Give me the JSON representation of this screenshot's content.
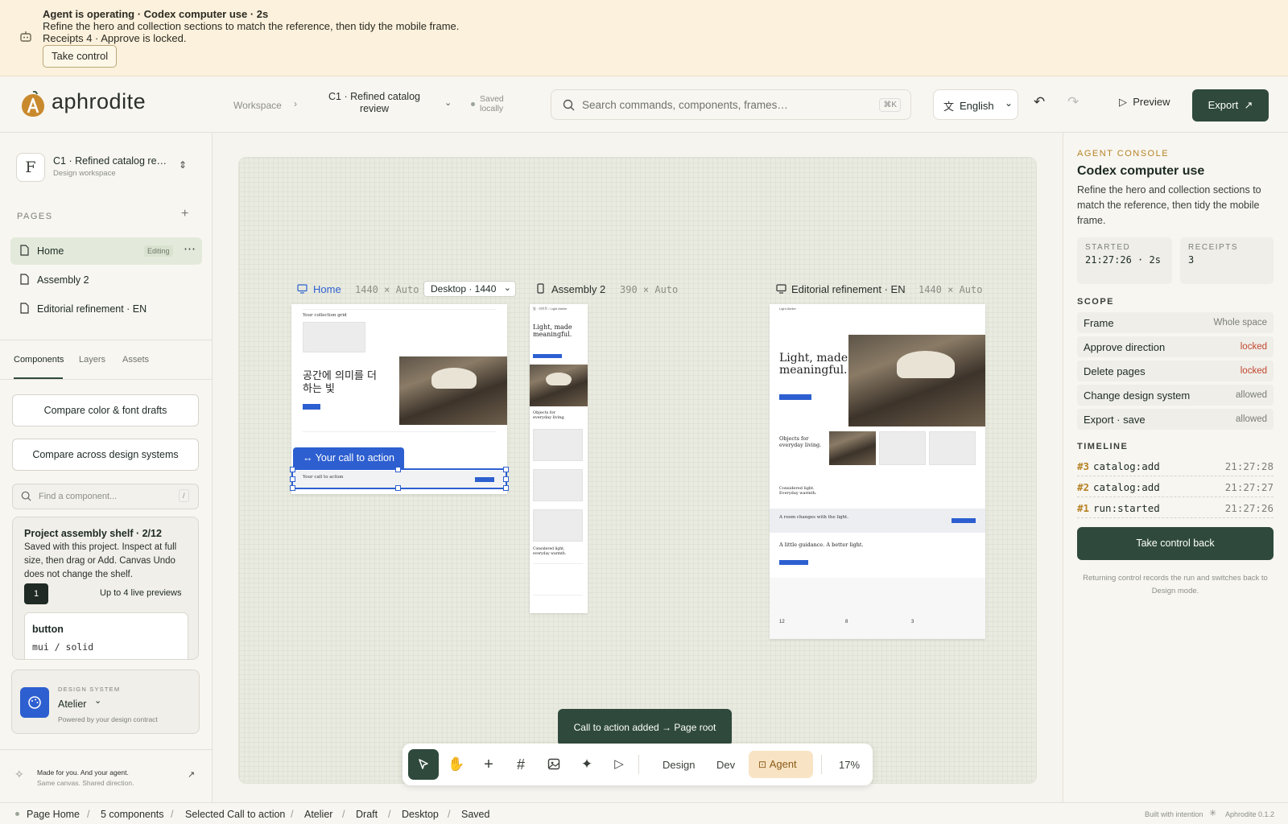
{
  "banner": {
    "title": "Agent is operating · Codex computer use · 2s",
    "line2": "Refine the hero and collection sections to match the reference, then tidy the mobile frame.",
    "line3": "Receipts 4 · Approve is locked.",
    "button": "Take control"
  },
  "header": {
    "logo_text": "aphrodite",
    "workspace": "Workspace",
    "file_title": "C1 · Refined catalog review",
    "saved": "Saved locally",
    "search_placeholder": "Search commands, components, frames…",
    "search_shortcut": "⌘K",
    "language": "English",
    "preview": "Preview",
    "export": "Export"
  },
  "sidebar": {
    "project_initial": "F",
    "project_name": "C1 · Refined catalog re…",
    "project_sub": "Design workspace",
    "pages_label": "PAGES",
    "pages": [
      {
        "label": "Home",
        "badge": "Editing"
      },
      {
        "label": "Assembly 2"
      },
      {
        "label": "Editorial refinement · EN"
      }
    ],
    "tabs": [
      "Components",
      "Layers",
      "Assets"
    ],
    "btn_compare_color": "Compare color & font drafts",
    "btn_compare_systems": "Compare across design systems",
    "find_placeholder": "Find a component...",
    "find_shortcut": "/",
    "shelf_title": "Project assembly shelf · 2/12",
    "shelf_text": "Saved with this project. Inspect at full size, then drag or Add. Canvas Undo does not change the shelf.",
    "shelf_count": "1",
    "shelf_limit": "Up to 4 live previews",
    "card_title": "button",
    "card_sub": "mui / solid",
    "ds_label": "DESIGN SYSTEM",
    "ds_name": "Atelier",
    "ds_sub": "Powered by your design contract",
    "footer_line1": "Made for you. And your agent.",
    "footer_line2": "Same canvas. Shared direction."
  },
  "canvas": {
    "frame1": {
      "label": "Home",
      "size": "1440 × Auto",
      "device": "Desktop · 1440"
    },
    "frame2": {
      "label": "Assembly 2",
      "size": "390 × Auto"
    },
    "frame3": {
      "label": "Editorial refinement · EN",
      "size": "1440 × Auto"
    },
    "home_heading_ko": "공간에 의미를 더하는 빛",
    "home_collection": "Your collection grid",
    "home_cta": "Your call to action",
    "cta_chip": "↔ Your call to action",
    "mob_brand": "빛 · 라이트 / Light Atelier",
    "mob_heading": "Light, made meaningful.",
    "mob_objects": "Objects for everyday living.",
    "mob_crafted": "Considered light, everyday warmth.",
    "ed_brand": "Light Atelier",
    "ed_heading": "Light, made meaningful.",
    "ed_objects": "Objects for everyday living.",
    "ed_crafted": "Considered light. Everyday warmth.",
    "ed_room": "A room changes with the light.",
    "ed_guidance": "A little guidance. A better light.",
    "ed_stats": [
      "12",
      "8",
      "3"
    ],
    "toast": "Call to action added → Page root"
  },
  "toolbar": {
    "modes": [
      "Design",
      "Dev",
      "Agent"
    ],
    "zoom": "17%"
  },
  "agent": {
    "label": "AGENT CONSOLE",
    "title": "Codex computer use",
    "desc": "Refine the hero and collection sections to match the reference, then tidy the mobile frame.",
    "started_label": "STARTED",
    "started_value": "21:27:26 · 2s",
    "receipts_label": "RECEIPTS",
    "receipts_value": "3",
    "scope_label": "SCOPE",
    "scope": [
      {
        "k": "Frame",
        "v": "Whole space",
        "color": "#7b7e78"
      },
      {
        "k": "Approve direction",
        "v": "locked",
        "color": "#c0462f"
      },
      {
        "k": "Delete pages",
        "v": "locked",
        "color": "#c0462f"
      },
      {
        "k": "Change design system",
        "v": "allowed",
        "color": "#7b7e78"
      },
      {
        "k": "Export · save",
        "v": "allowed",
        "color": "#7b7e78"
      }
    ],
    "timeline_label": "TIMELINE",
    "timeline": [
      {
        "id": "#3",
        "event": "catalog:add",
        "time": "21:27:28"
      },
      {
        "id": "#2",
        "event": "catalog:add",
        "time": "21:27:27"
      },
      {
        "id": "#1",
        "event": "run:started",
        "time": "21:27:26"
      }
    ],
    "button": "Take control back",
    "note": "Returning control records the run and switches back to Design mode."
  },
  "status": {
    "items": [
      "Page Home",
      "5 components",
      "Selected Call to action",
      "Atelier",
      "Draft",
      "Desktop",
      "Saved"
    ],
    "built": "Built with intention",
    "version": "Aphrodite 0.1.2"
  }
}
